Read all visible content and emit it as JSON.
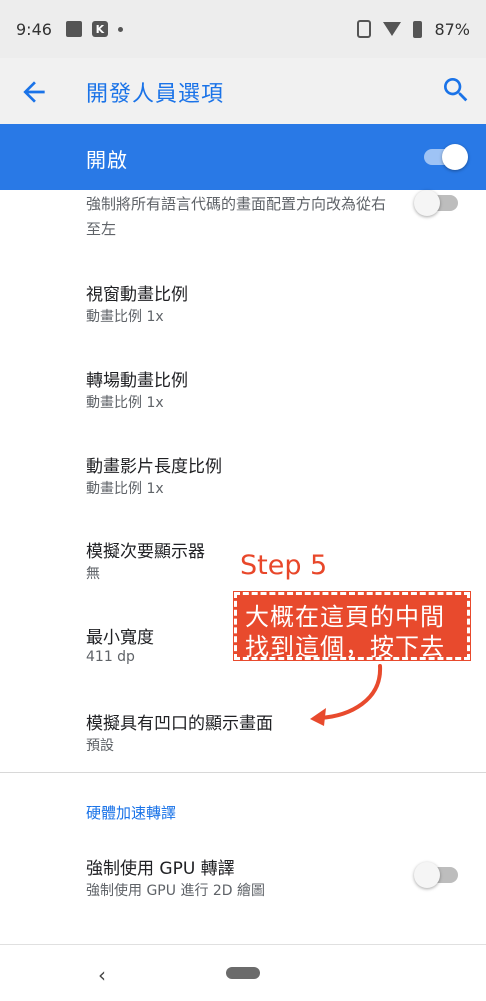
{
  "status_bar": {
    "time": "9:46",
    "battery": "87%",
    "icons": [
      "image-icon",
      "k-app-icon",
      "dot-icon",
      "vibrate-icon",
      "wifi-icon",
      "battery-icon"
    ]
  },
  "app_bar": {
    "title": "開發人員選項",
    "back_icon": "arrow-back-icon",
    "search_icon": "search-icon",
    "accent": "#1a73e8"
  },
  "master": {
    "label": "開啟",
    "enabled": true,
    "color": "#2979e6"
  },
  "rtl_item": {
    "summary": "強制將所有語言代碼的畫面配置方向改為從右至左",
    "enabled": false
  },
  "preferences": [
    {
      "title": "視窗動畫比例",
      "summary": "動畫比例 1x"
    },
    {
      "title": "轉場動畫比例",
      "summary": "動畫比例 1x"
    },
    {
      "title": "動畫影片長度比例",
      "summary": "動畫比例 1x"
    },
    {
      "title": "模擬次要顯示器",
      "summary": "無"
    },
    {
      "title": "最小寬度",
      "summary": "411 dp"
    },
    {
      "title": "模擬具有凹口的顯示畫面",
      "summary": "預設"
    }
  ],
  "section": {
    "header": "硬體加速轉譯"
  },
  "gpu_item": {
    "title": "強制使用 GPU 轉譯",
    "summary": "強制使用 GPU 進行 2D 繪圖",
    "enabled": false
  },
  "annotation": {
    "step": "Step 5",
    "line1": "大概在這頁的中間",
    "line2": "找到這個，按下去",
    "color": "#e84a2d"
  },
  "nav_bar": {
    "back": "‹"
  }
}
